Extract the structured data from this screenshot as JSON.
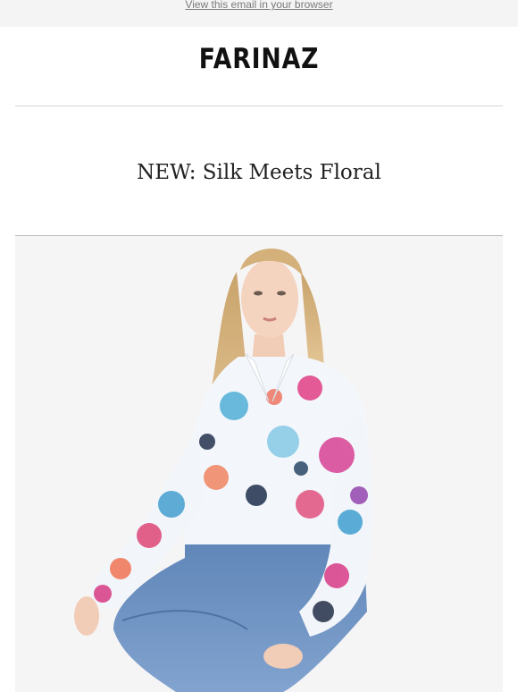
{
  "preheader": {
    "view_in_browser": "View this email in your browser"
  },
  "brand": {
    "logo_text": "FARINAZ"
  },
  "headline": "NEW: Silk Meets Floral",
  "hero": {
    "image_alt": "Model wearing floral silk shirt and blue jeans, seated on a white stool"
  },
  "colors": {
    "background": "#ffffff",
    "preheader_bg": "#f4f4f4",
    "hero_bg": "#f6f5f6",
    "denim": "#6f93c2",
    "hair": "#d9b67e"
  }
}
